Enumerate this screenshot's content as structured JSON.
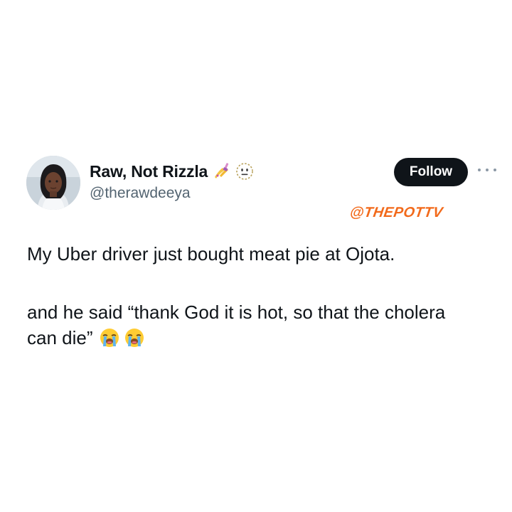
{
  "user": {
    "display_name": "Raw, Not Rizzla",
    "handle": "@therawdeeya",
    "name_emojis": [
      "nail-polish-icon",
      "dotted-line-face-icon"
    ]
  },
  "actions": {
    "follow_label": "Follow",
    "more_icon": "more-dots-icon"
  },
  "watermark": "@THEPOTTV",
  "tweet": {
    "line_1": "My Uber driver just bought meat pie at Ojota.",
    "line_2": "and he said “thank God it is hot, so that the cholera",
    "line_3": "can die”",
    "trailing_emojis": [
      "loudly-crying-face-icon",
      "loudly-crying-face-icon"
    ]
  },
  "colors": {
    "follow_button_bg": "#0f1419",
    "follow_button_text": "#ffffff",
    "handle_text": "#536471",
    "watermark": "#f26a1b"
  }
}
